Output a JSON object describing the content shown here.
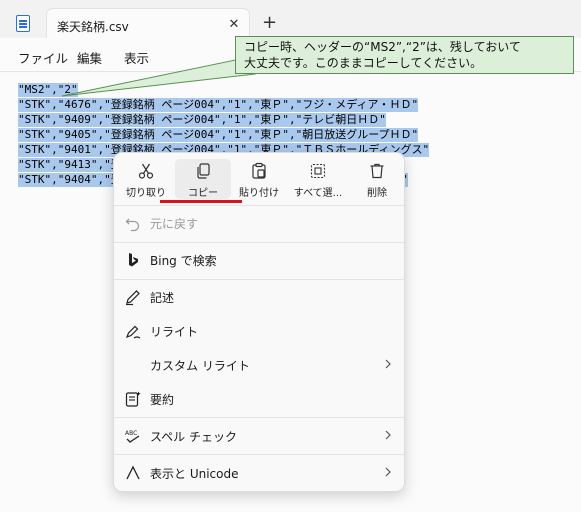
{
  "window": {
    "tab_title": "楽天銘柄.csv",
    "close_glyph": "✕",
    "new_tab_glyph": "+"
  },
  "menubar": {
    "file": "ファイル",
    "edit": "編集",
    "view": "表示"
  },
  "editor": {
    "lines": [
      "\"MS2\",\"2\"",
      "\"STK\",\"4676\",\"登録銘柄 ページ004\",\"1\",\"東Ｐ\",\"フジ・メディア・ＨＤ\"",
      "\"STK\",\"9409\",\"登録銘柄 ページ004\",\"1\",\"東Ｐ\",\"テレビ朝日ＨＤ\"",
      "\"STK\",\"9405\",\"登録銘柄 ページ004\",\"1\",\"東Ｐ\",\"朝日放送グループＨＤ\"",
      "\"STK\",\"9401\",\"登録銘柄 ページ004\",\"1\",\"東Ｐ\",\"ＴＢＳホールディングス\"",
      "\"STK\",\"9413\",\"登録銘柄 ページ004\",\"1\",\"東Ｐ\",\"テレビ東京ＨＤ\"",
      "\"STK\",\"9404\",\"登録銘柄 ページ004\",\"1\",\"東Ｐ\",\"日本テレビＨＬＤＳ\""
    ]
  },
  "callout": {
    "line1": "コピー時、ヘッダーの“MS2”,“2”は、残しておいて",
    "line2": "大丈夫です。このままコピーしてください。"
  },
  "context_menu": {
    "toolbar": {
      "cut": "切り取り",
      "copy": "コピー",
      "paste": "貼り付け",
      "select_all": "すべて選...",
      "delete": "削除"
    },
    "items": {
      "undo": "元に戻す",
      "bing": "Bing で検索",
      "describe": "記述",
      "rewrite": "リライト",
      "custom_rewrite": "カスタム リライト",
      "summarize": "要約",
      "spellcheck": "スペル チェック",
      "unicode": "表示と Unicode"
    }
  },
  "colors": {
    "selection": "#a9c8ee",
    "callout_bg": "#dcefd8",
    "callout_border": "#5a8f55",
    "accent_underline": "#d9141b"
  },
  "icons": [
    "notepad-icon",
    "scissors-icon",
    "copy-icon",
    "paste-icon",
    "select-all-icon",
    "trash-icon",
    "undo-icon",
    "bing-icon",
    "pen-icon",
    "rewrite-icon",
    "summary-icon",
    "spellcheck-icon",
    "unicode-icon",
    "chevron-right-icon"
  ]
}
